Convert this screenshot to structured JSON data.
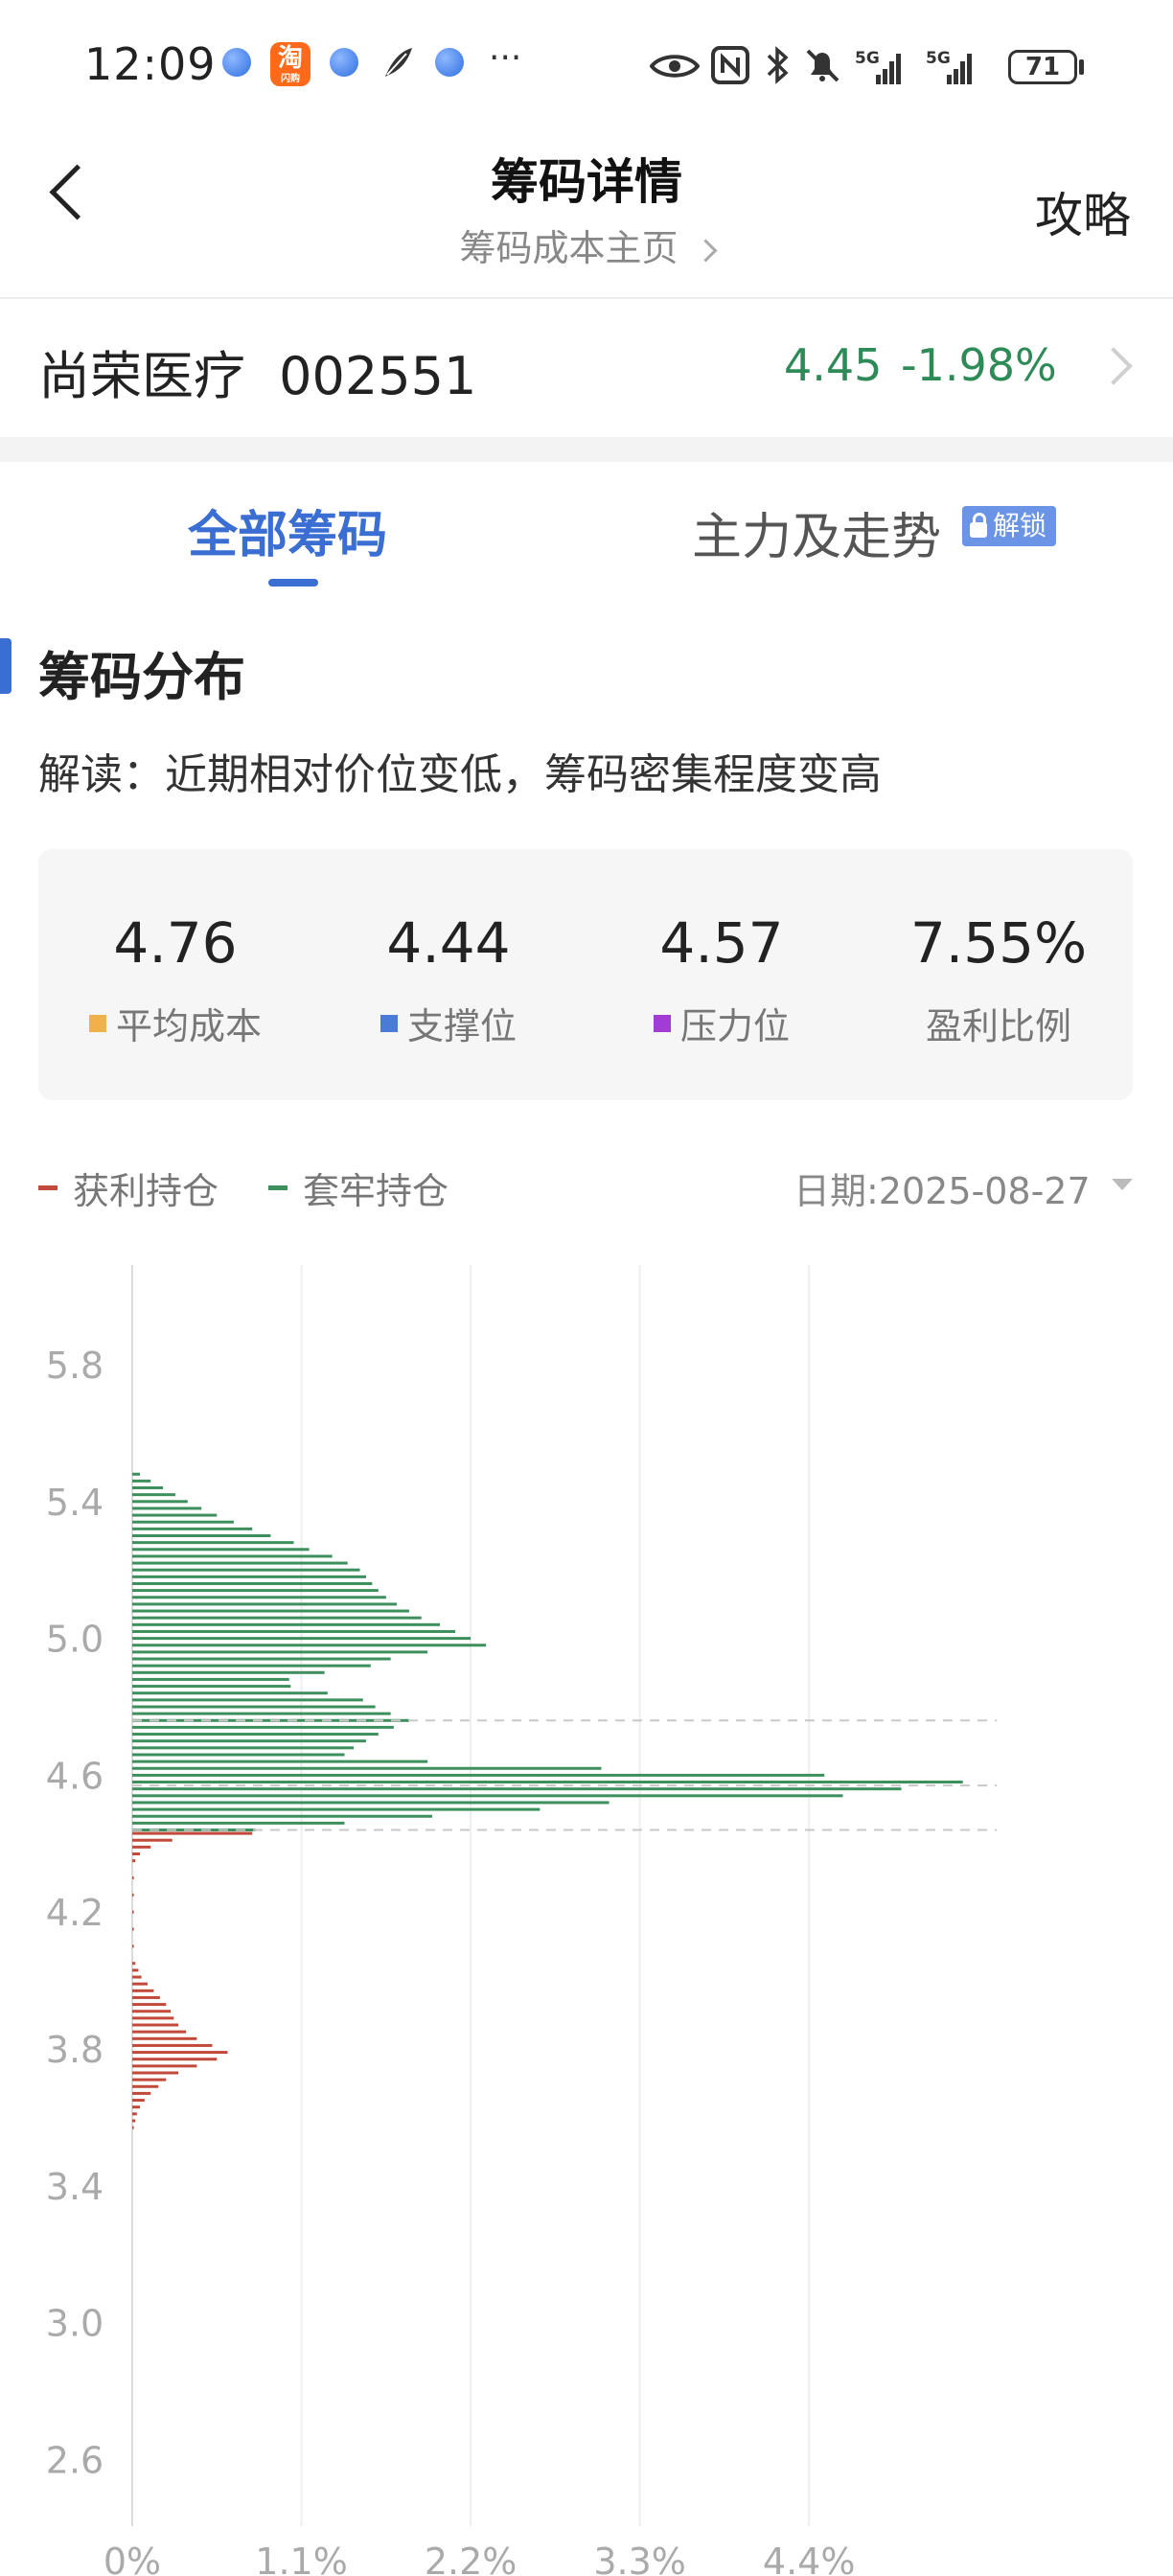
{
  "status_bar": {
    "time": "12:09",
    "taobao_label": "淘",
    "taobao_sub": "闪购",
    "more": "···",
    "battery": "71"
  },
  "header": {
    "back_label": "",
    "title": "筹码详情",
    "subtitle": "筹码成本主页",
    "right_action": "攻略"
  },
  "stock": {
    "name": "尚荣医疗",
    "code": "002551",
    "price": "4.45",
    "change": "-1.98%"
  },
  "tabs": [
    {
      "label": "全部筹码",
      "active": true
    },
    {
      "label": "主力及走势",
      "active": false,
      "badge": "解锁"
    }
  ],
  "section": {
    "title": "筹码分布",
    "interpretation": "解读：近期相对价位变低，筹码密集程度变高"
  },
  "stats": [
    {
      "value": "4.76",
      "label": "平均成本",
      "color": "#f0b04a"
    },
    {
      "value": "4.44",
      "label": "支撑位",
      "color": "#4a7bd6"
    },
    {
      "value": "4.57",
      "label": "压力位",
      "color": "#a33bd6"
    },
    {
      "value": "7.55%",
      "label": "盈利比例",
      "color": ""
    }
  ],
  "legend": [
    {
      "label": "获利持仓",
      "color": "#c24a3a"
    },
    {
      "label": "套牢持仓",
      "color": "#3e8f5e"
    }
  ],
  "date_label": "日期:2025-08-27",
  "chart_data": {
    "type": "bar",
    "orientation": "horizontal",
    "y_axis": {
      "range": [
        2.6,
        5.8
      ],
      "ticks": [
        "5.8",
        "5.4",
        "5.0",
        "4.6",
        "4.2",
        "3.8",
        "3.4",
        "3.0",
        "2.6"
      ]
    },
    "x_axis": {
      "ticks": [
        "0%",
        "1.1%",
        "2.2%",
        "3.3%",
        "4.4%"
      ]
    },
    "grid": true,
    "reference_lines": [
      {
        "price": 4.76,
        "label": "4.76",
        "color": "#e0a83e"
      },
      {
        "price": 4.57,
        "label": "4.57",
        "color": "#8a4fd0"
      },
      {
        "price": 4.44,
        "label": "4.44",
        "color": "#4a7bd6"
      }
    ],
    "series": [
      {
        "name": "套牢持仓",
        "color": "#3e8f5e",
        "points": [
          [
            5.48,
            0.05
          ],
          [
            5.46,
            0.12
          ],
          [
            5.44,
            0.2
          ],
          [
            5.42,
            0.28
          ],
          [
            5.4,
            0.36
          ],
          [
            5.38,
            0.45
          ],
          [
            5.36,
            0.55
          ],
          [
            5.34,
            0.66
          ],
          [
            5.32,
            0.78
          ],
          [
            5.3,
            0.9
          ],
          [
            5.28,
            1.05
          ],
          [
            5.26,
            1.15
          ],
          [
            5.24,
            1.3
          ],
          [
            5.22,
            1.4
          ],
          [
            5.2,
            1.48
          ],
          [
            5.18,
            1.52
          ],
          [
            5.16,
            1.56
          ],
          [
            5.14,
            1.6
          ],
          [
            5.12,
            1.65
          ],
          [
            5.1,
            1.72
          ],
          [
            5.08,
            1.8
          ],
          [
            5.06,
            1.88
          ],
          [
            5.04,
            2.0
          ],
          [
            5.02,
            2.1
          ],
          [
            5.0,
            2.2
          ],
          [
            4.98,
            2.3
          ],
          [
            4.96,
            1.92
          ],
          [
            4.94,
            1.68
          ],
          [
            4.92,
            1.55
          ],
          [
            4.9,
            1.25
          ],
          [
            4.88,
            1.02
          ],
          [
            4.86,
            1.03
          ],
          [
            4.84,
            1.27
          ],
          [
            4.82,
            1.5
          ],
          [
            4.8,
            1.58
          ],
          [
            4.78,
            1.68
          ],
          [
            4.76,
            1.8
          ],
          [
            4.74,
            1.7
          ],
          [
            4.72,
            1.6
          ],
          [
            4.7,
            1.52
          ],
          [
            4.68,
            1.44
          ],
          [
            4.66,
            1.38
          ],
          [
            4.64,
            1.92
          ],
          [
            4.62,
            3.05
          ],
          [
            4.6,
            4.5
          ],
          [
            4.58,
            5.4
          ],
          [
            4.56,
            5.0
          ],
          [
            4.54,
            4.62
          ],
          [
            4.52,
            3.1
          ],
          [
            4.5,
            2.65
          ],
          [
            4.48,
            1.95
          ],
          [
            4.46,
            1.38
          ],
          [
            4.44,
            0.8
          ]
        ]
      },
      {
        "name": "获利持仓",
        "color": "#c24a3a",
        "points": [
          [
            4.43,
            0.78
          ],
          [
            4.41,
            0.26
          ],
          [
            4.39,
            0.12
          ],
          [
            4.37,
            0.05
          ],
          [
            4.35,
            0.02
          ],
          [
            4.3,
            0.01
          ],
          [
            4.25,
            0.01
          ],
          [
            4.2,
            0.01
          ],
          [
            4.15,
            0.01
          ],
          [
            4.1,
            0.01
          ],
          [
            4.05,
            0.02
          ],
          [
            4.03,
            0.04
          ],
          [
            4.01,
            0.06
          ],
          [
            3.99,
            0.1
          ],
          [
            3.97,
            0.14
          ],
          [
            3.95,
            0.18
          ],
          [
            3.93,
            0.22
          ],
          [
            3.91,
            0.25
          ],
          [
            3.89,
            0.27
          ],
          [
            3.87,
            0.3
          ],
          [
            3.85,
            0.35
          ],
          [
            3.83,
            0.42
          ],
          [
            3.81,
            0.52
          ],
          [
            3.79,
            0.62
          ],
          [
            3.77,
            0.55
          ],
          [
            3.75,
            0.42
          ],
          [
            3.73,
            0.3
          ],
          [
            3.71,
            0.22
          ],
          [
            3.69,
            0.17
          ],
          [
            3.67,
            0.12
          ],
          [
            3.65,
            0.08
          ],
          [
            3.63,
            0.05
          ],
          [
            3.61,
            0.03
          ],
          [
            3.59,
            0.02
          ],
          [
            3.57,
            0.01
          ]
        ]
      }
    ]
  }
}
